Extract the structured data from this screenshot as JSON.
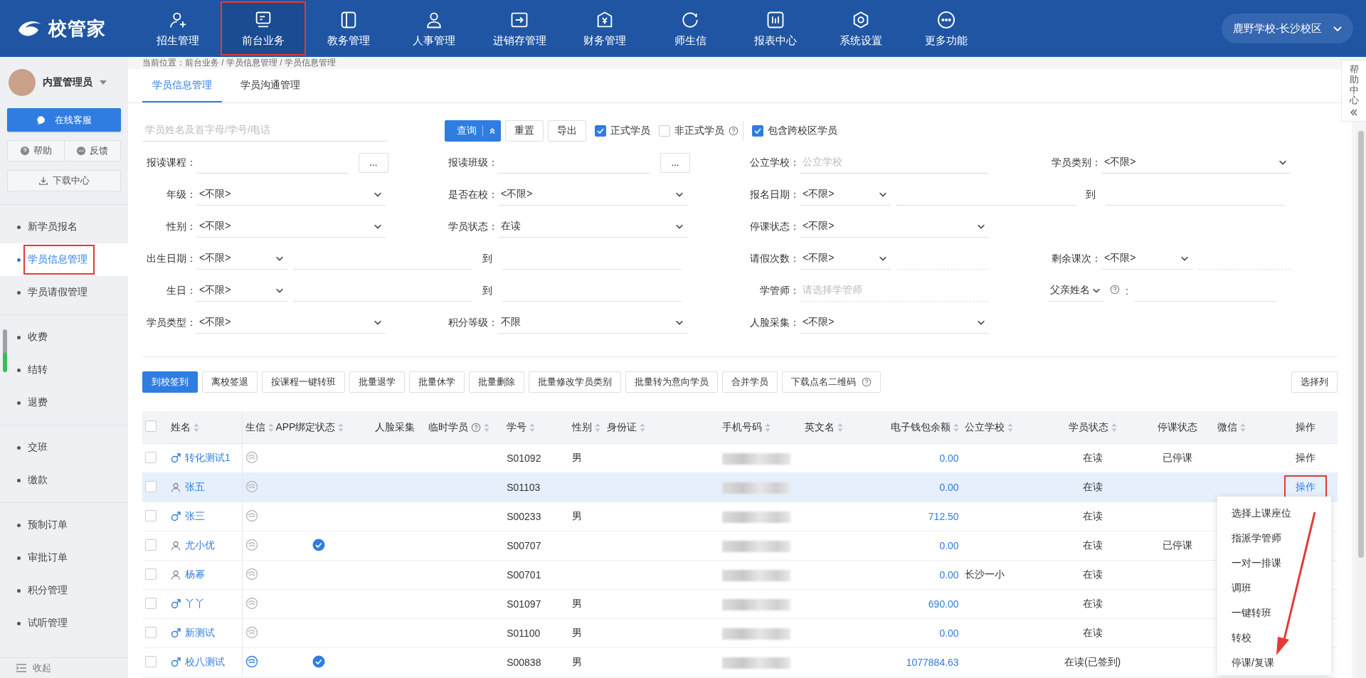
{
  "header": {
    "logo": "校管家",
    "campus": "鹿野学校-长沙校区",
    "nav": [
      {
        "label": "招生管理",
        "selected": false,
        "highlighted": false
      },
      {
        "label": "前台业务",
        "selected": true,
        "highlighted": true
      },
      {
        "label": "教务管理",
        "selected": false,
        "highlighted": false
      },
      {
        "label": "人事管理",
        "selected": false,
        "highlighted": false
      },
      {
        "label": "进销存管理",
        "selected": false,
        "highlighted": false
      },
      {
        "label": "财务管理",
        "selected": false,
        "highlighted": false
      },
      {
        "label": "师生信",
        "selected": false,
        "highlighted": false
      },
      {
        "label": "报表中心",
        "selected": false,
        "highlighted": false
      },
      {
        "label": "系统设置",
        "selected": false,
        "highlighted": false
      },
      {
        "label": "更多功能",
        "selected": false,
        "highlighted": false
      }
    ]
  },
  "sidebar": {
    "user": "内置管理员",
    "service": "在线客服",
    "help": "帮助",
    "feedback": "反馈",
    "download": "下载中心",
    "collapse": "收起",
    "groups": [
      [
        {
          "label": "新学员报名",
          "selected": false,
          "highlighted": false
        },
        {
          "label": "学员信息管理",
          "selected": true,
          "highlighted": true
        },
        {
          "label": "学员请假管理",
          "selected": false,
          "highlighted": false
        }
      ],
      [
        {
          "label": "收费",
          "selected": false,
          "highlighted": false
        },
        {
          "label": "结转",
          "selected": false,
          "highlighted": false
        },
        {
          "label": "退费",
          "selected": false,
          "highlighted": false
        }
      ],
      [
        {
          "label": "交班",
          "selected": false,
          "highlighted": false
        },
        {
          "label": "缴款",
          "selected": false,
          "highlighted": false
        }
      ],
      [
        {
          "label": "预制订单",
          "selected": false,
          "highlighted": false
        },
        {
          "label": "审批订单",
          "selected": false,
          "highlighted": false
        },
        {
          "label": "积分管理",
          "selected": false,
          "highlighted": false
        },
        {
          "label": "试听管理",
          "selected": false,
          "highlighted": false
        }
      ]
    ]
  },
  "breadcrumb": "当前位置：前台业务 / 学员信息管理 / 学员信息管理",
  "tabs": [
    {
      "label": "学员信息管理",
      "selected": true
    },
    {
      "label": "学员沟通管理",
      "selected": false
    }
  ],
  "filters": {
    "search": {
      "placeholder": "学员姓名及首字母/学号/电话"
    },
    "buttons": [
      {
        "label": "查询",
        "kind": "split"
      },
      {
        "label": "重置",
        "kind": "plain"
      },
      {
        "label": "导出",
        "kind": "plain"
      }
    ],
    "checks": [
      {
        "kind": "checkbox",
        "label": "正式学员",
        "checked": true
      },
      {
        "kind": "checkbox_help",
        "label": "非正式学员",
        "checked": false
      },
      {
        "kind": "divider"
      },
      {
        "kind": "checkbox",
        "label": "包含跨校区学员",
        "checked": true
      }
    ],
    "rows": [
      [
        {
          "kind": "input_more",
          "label": "报读课程：",
          "more": "..."
        },
        {
          "kind": "input_more",
          "label": "报读班级：",
          "more": "..."
        },
        {
          "kind": "input",
          "label": "公立学校：",
          "placeholder": "公立学校"
        },
        {
          "kind": "select",
          "label": "学员类别：",
          "value": "<不限>"
        }
      ],
      [
        {
          "kind": "select",
          "label": "年级：",
          "value": "<不限>"
        },
        {
          "kind": "select",
          "label": "是否在校：",
          "value": "<不限>"
        },
        {
          "kind": "range",
          "label": "报名日期：",
          "value": "<不限>",
          "to": "到"
        }
      ],
      [
        {
          "kind": "select",
          "label": "性别：",
          "value": "<不限>"
        },
        {
          "kind": "select",
          "label": "学员状态：",
          "value": "在读"
        },
        {
          "kind": "select",
          "label": "停课状态：",
          "value": "<不限>"
        }
      ],
      [
        {
          "kind": "range",
          "label": "出生日期：",
          "value": "<不限>",
          "to": "到"
        },
        {
          "kind": "count",
          "label": "请假次数：",
          "value": "<不限>"
        },
        {
          "kind": "count",
          "label": "剩余课次：",
          "value": "<不限>"
        }
      ],
      [
        {
          "kind": "range",
          "label": "生日：",
          "value": "<不限>",
          "to": "到"
        },
        {
          "kind": "picker",
          "label": "学管师：",
          "placeholder": "请选择学管师"
        },
        {
          "kind": "keyed",
          "value": "父亲姓名",
          "sep": ":"
        }
      ],
      [
        {
          "kind": "select",
          "label": "学员类型：",
          "value": "<不限>"
        },
        {
          "kind": "select",
          "label": "积分等级：",
          "value": "不限"
        },
        {
          "kind": "select",
          "label": "人脸采集：",
          "value": "<不限>"
        }
      ]
    ]
  },
  "toolbar": {
    "columns_button": "选择列",
    "buttons": [
      {
        "label": "到校签到",
        "kind": "primary"
      },
      {
        "label": "离校签退",
        "kind": "plain"
      },
      {
        "label": "按课程一键转班",
        "kind": "plain"
      },
      {
        "label": "批量退学",
        "kind": "plain"
      },
      {
        "label": "批量休学",
        "kind": "plain"
      },
      {
        "label": "批量删除",
        "kind": "plain"
      },
      {
        "label": "批量修改学员类别",
        "kind": "plain"
      },
      {
        "label": "批量转为意向学员",
        "kind": "plain"
      },
      {
        "label": "合并学员",
        "kind": "plain"
      },
      {
        "label": "下载点名二维码",
        "kind": "plain_help"
      }
    ]
  },
  "table": {
    "all_checked": false,
    "columns": [
      {
        "label": "姓名",
        "kind": "sortable"
      },
      {
        "label": "生信",
        "kind": "sortable"
      },
      {
        "label": "APP绑定状态",
        "kind": "sortable"
      },
      {
        "label": "人脸采集",
        "kind": "plain"
      },
      {
        "label": "临时学员",
        "kind": "help_sortable"
      },
      {
        "label": "学号",
        "kind": "sortable"
      },
      {
        "label": "性别",
        "kind": "sortable"
      },
      {
        "label": "身份证",
        "kind": "sortable"
      },
      {
        "label": "手机号码",
        "kind": "sortable"
      },
      {
        "label": "英文名",
        "kind": "sortable"
      },
      {
        "label": "电子钱包余额",
        "kind": "sortable"
      },
      {
        "label": "公立学校",
        "kind": "sortable"
      },
      {
        "label": "学员状态",
        "kind": "sortable"
      },
      {
        "label": "停课状态",
        "kind": "plain"
      },
      {
        "label": "微信",
        "kind": "sortable"
      },
      {
        "label": "操作",
        "kind": "plain"
      }
    ],
    "rows": [
      {
        "checked": false,
        "hovered": false,
        "male": true,
        "name": "转化测试1",
        "sx_bound": false,
        "app_bound": false,
        "student_no": "S01092",
        "sex": "男",
        "balance": "0.00",
        "status": "在读",
        "suspend": "已停课",
        "op": "操作",
        "op_active": false,
        "op_highlighted": false
      },
      {
        "checked": false,
        "hovered": true,
        "male": false,
        "name": "张五",
        "sx_bound": false,
        "app_bound": false,
        "student_no": "S01103",
        "balance": "0.00",
        "status": "在读",
        "op": "操作",
        "op_active": true,
        "op_highlighted": true
      },
      {
        "checked": false,
        "hovered": false,
        "male": true,
        "name": "张三",
        "sx_bound": false,
        "app_bound": false,
        "student_no": "S00233",
        "sex": "男",
        "balance": "712.50",
        "status": "在读"
      },
      {
        "checked": false,
        "hovered": false,
        "male": false,
        "name": "尤小优",
        "sx_bound": false,
        "app_bound": true,
        "student_no": "S00707",
        "balance": "0.00",
        "status": "在读",
        "suspend": "已停课"
      },
      {
        "checked": false,
        "hovered": false,
        "male": false,
        "name": "杨幂",
        "sx_bound": false,
        "app_bound": false,
        "student_no": "S00701",
        "balance": "0.00",
        "school": "长沙一小",
        "status": "在读"
      },
      {
        "checked": false,
        "hovered": false,
        "male": true,
        "name": "丫丫",
        "sx_bound": false,
        "app_bound": false,
        "student_no": "S01097",
        "sex": "男",
        "balance": "690.00",
        "status": "在读"
      },
      {
        "checked": false,
        "hovered": false,
        "male": true,
        "name": "新测试",
        "sx_bound": false,
        "app_bound": false,
        "student_no": "S01100",
        "sex": "男",
        "balance": "0.00",
        "status": "在读"
      },
      {
        "checked": false,
        "hovered": false,
        "male": true,
        "name": "校八测试",
        "sx_bound": true,
        "app_bound": true,
        "student_no": "S00838",
        "sex": "男",
        "balance": "1077884.63",
        "status": "在读(已签到)"
      }
    ]
  },
  "row_menu": {
    "items": [
      "选择上课座位",
      "指派学管师",
      "一对一排课",
      "调班",
      "一键转班",
      "转校",
      "停课/复课"
    ]
  },
  "help_center": "帮助中心"
}
